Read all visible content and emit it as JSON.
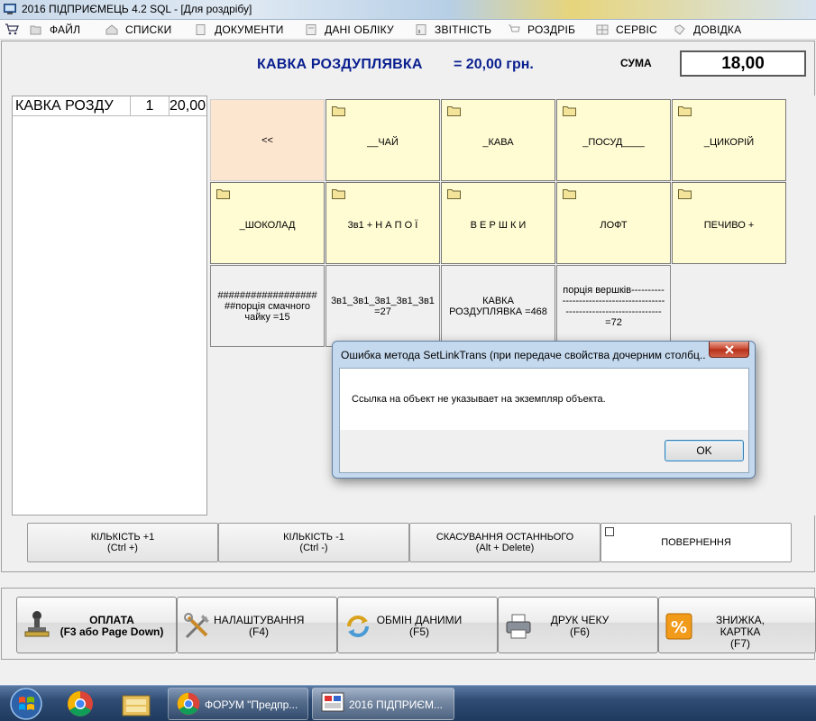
{
  "window": {
    "title": "2016  ПІДПРИЄМЕЦЬ 4.2 SQL - [Для роздрібу]"
  },
  "menu": [
    {
      "label": "ФАЙЛ",
      "icon": "folder-open-icon"
    },
    {
      "label": "СПИСКИ",
      "icon": "home-icon"
    },
    {
      "label": "ДОКУМЕНТИ",
      "icon": "document-icon"
    },
    {
      "label": "ДАНІ ОБЛІКУ",
      "icon": "ledger-icon"
    },
    {
      "label": "ЗВІТНІСТЬ",
      "icon": "report-icon"
    },
    {
      "label": "РОЗДРІБ",
      "icon": "cart-icon"
    },
    {
      "label": "СЕРВІС",
      "icon": "grid-icon"
    },
    {
      "label": "ДОВІДКА",
      "icon": "book-icon"
    }
  ],
  "header": {
    "product": "КАВКА РОЗДУПЛЯВКА",
    "price": "= 20,00 грн.",
    "sum_label": "СУМА",
    "sum_value": "18,00"
  },
  "receipt": {
    "rows": [
      {
        "name": "КАВКА РОЗДУ",
        "qty": "1",
        "price": "20,00"
      }
    ]
  },
  "tiles": [
    {
      "label": "<<",
      "kind": "back"
    },
    {
      "label": "__ЧАЙ",
      "kind": "folder"
    },
    {
      "label": "_КАВА",
      "kind": "folder"
    },
    {
      "label": "_ПОСУД____",
      "kind": "folder"
    },
    {
      "label": "_ЦИКОРІЙ",
      "kind": "folder"
    },
    {
      "label": "_ШОКОЛАД",
      "kind": "folder"
    },
    {
      "label": "3в1 + Н А П О Ї",
      "kind": "folder"
    },
    {
      "label": "В Е Р Ш К И",
      "kind": "folder"
    },
    {
      "label": "ЛОФТ",
      "kind": "folder"
    },
    {
      "label": "ПЕЧИВО +",
      "kind": "folder"
    },
    {
      "label": "##################\n##порція  смачного\nчайку  =15",
      "kind": "product"
    },
    {
      "label": "3в1_3в1_3в1_3в1_3в1\n=27",
      "kind": "product"
    },
    {
      "label": "КАВКА\nРОЗДУПЛЯВКА  =468",
      "kind": "product"
    },
    {
      "label": "порція  вершків----------\n-------------------------------\n-----------------------------\n=72",
      "kind": "product"
    }
  ],
  "actions": [
    {
      "label": "КІЛЬКІСТЬ +1",
      "hotkey": "(Ctrl +)"
    },
    {
      "label": "КІЛЬКІСТЬ -1",
      "hotkey": "(Ctrl -)"
    },
    {
      "label": "СКАСУВАННЯ ОСТАННЬОГО",
      "hotkey": "(Alt + Delete)"
    },
    {
      "label": "ПОВЕРНЕННЯ",
      "hotkey": ""
    }
  ],
  "toolbar": [
    {
      "label": "ОПЛАТА",
      "hotkey": "(F3 або Page Down)",
      "icon": "stamp-icon"
    },
    {
      "label": "НАЛАШТУВАННЯ",
      "hotkey": "(F4)",
      "icon": "tools-icon"
    },
    {
      "label": "ОБМІН ДАНИМИ",
      "hotkey": "(F5)",
      "icon": "refresh-icon"
    },
    {
      "label": "ДРУК ЧЕКУ",
      "hotkey": "(F6)",
      "icon": "printer-icon"
    },
    {
      "label": "ЗНИЖКА, КАРТКА",
      "hotkey": "(F7)",
      "icon": "percent-icon"
    }
  ],
  "dialog": {
    "title": "Ошибка метода SetLinkTrans (при передаче свойства дочерним столбц...",
    "message": "Ссылка на объект не указывает на экземпляр объекта.",
    "ok_label": "OK"
  },
  "taskbar": {
    "tasks": [
      {
        "label": "ФОРУМ \"Предпр...",
        "icon": "chrome-icon"
      },
      {
        "label": "2016  ПІДПРИЄМ...",
        "icon": "app-icon"
      }
    ]
  },
  "colors": {
    "header_text": "#0a1f8f",
    "folder_tile": "#fffcd4",
    "back_tile": "#fde6cf"
  }
}
